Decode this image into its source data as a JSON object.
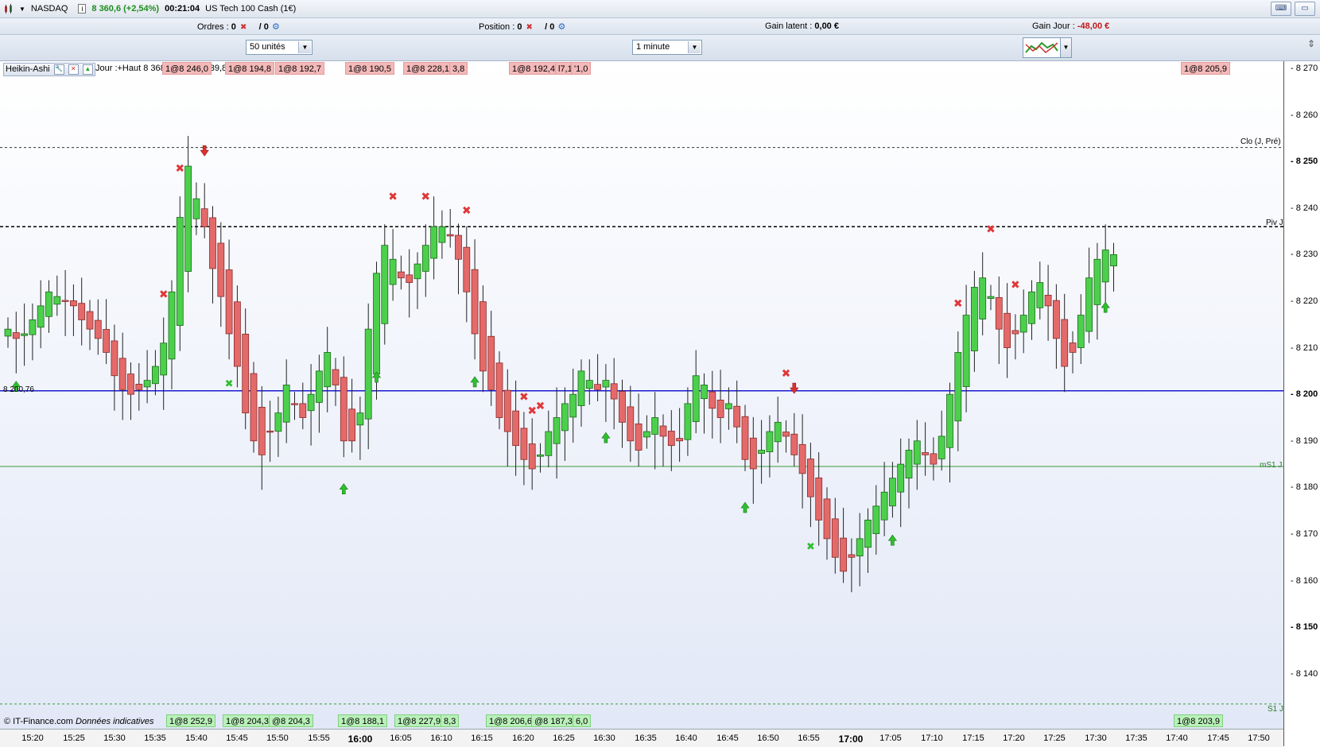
{
  "titlebar": {
    "symbol": "NASDAQ",
    "last": "8 360,6 (+2,54%)",
    "time": "00:21:04",
    "instrument": "US Tech 100 Cash (1€)"
  },
  "infobar": {
    "ordres_label": "Ordres :",
    "ordres_value": "0",
    "ordres_slash": "/ 0",
    "position_label": "Position :",
    "position_value": "0",
    "position_slash": "/ 0",
    "gain_latent_label": "Gain latent :",
    "gain_latent_value": "0,00 €",
    "gain_jour_label": "Gain Jour :",
    "gain_jour_value": "-48,00 €"
  },
  "controls": {
    "quantity": "50 unités",
    "timeframe": "1 minute"
  },
  "chart_header": {
    "style": "Heikin-Ashi",
    "ohlc": "Jour :+Haut 8 368,7 +Bas 8 039,8"
  },
  "top_tags": [
    "1@8 246,0",
    "1@8 194,8",
    "1@8 192,7",
    "1@8 190,5",
    "1@8 228,1",
    "3,8",
    "1@8 192,4",
    "l7,1",
    "'1,0",
    "1@8 205,9"
  ],
  "bottom_tags": [
    "1@8 252,9",
    "1@8 204,3",
    "@8 204,3",
    "1@8 188,1",
    "1@8 227,9",
    "8,3",
    "1@8 206,6",
    "@8 187,3",
    "6,0",
    "1@8 203,9"
  ],
  "footer": {
    "credit": "© IT-Finance.com",
    "note": "Données indicatives"
  },
  "line_labels": {
    "clo": "Clo (J, Pré)",
    "piv": "Piv J",
    "price_line": "8 200,76",
    "ms1": "mS1 J",
    "s1": "S1 J"
  },
  "chart_data": {
    "type": "candlestick",
    "style": "Heikin-Ashi",
    "ylim": [
      8132,
      8272
    ],
    "y_ticks": [
      8140,
      8150,
      8160,
      8170,
      8180,
      8190,
      8200,
      8210,
      8220,
      8230,
      8240,
      8250,
      8260,
      8270
    ],
    "y_ticks_bold": [
      8150,
      8200,
      8250
    ],
    "x_ticks": [
      "15:20",
      "15:25",
      "15:30",
      "15:35",
      "15:40",
      "15:45",
      "15:50",
      "15:55",
      "16:00",
      "16:05",
      "16:10",
      "16:15",
      "16:20",
      "16:25",
      "16:30",
      "16:35",
      "16:40",
      "16:45",
      "16:50",
      "16:55",
      "17:00",
      "17:05",
      "17:10",
      "17:15",
      "17:20",
      "17:25",
      "17:30",
      "17:35",
      "17:40",
      "17:45",
      "17:50"
    ],
    "x_ticks_bold": [
      "16:00",
      "17:00"
    ],
    "lines": {
      "clo": 8253,
      "piv": 8236,
      "price": 8200.76,
      "ms1": 8184.5,
      "s1": 8133.5
    },
    "closes": [
      8214,
      8212,
      8213,
      8216,
      8219,
      8222,
      8221,
      8220,
      8219,
      8216,
      8214,
      8212,
      8209,
      8204,
      8201,
      8200,
      8201,
      8203,
      8206,
      8211,
      8222,
      8238,
      8249,
      8242,
      8236,
      8227,
      8221,
      8213,
      8206,
      8196,
      8190,
      8187,
      8192,
      8196,
      8202,
      8198,
      8195,
      8200,
      8205,
      8209,
      8202,
      8190,
      8190,
      8196,
      8214,
      8226,
      8232,
      8229,
      8225,
      8224,
      8228,
      8232,
      8236,
      8236,
      8234,
      8229,
      8222,
      8213,
      8205,
      8201,
      8195,
      8192,
      8189,
      8186,
      8184,
      8187,
      8192,
      8195,
      8198,
      8200,
      8205,
      8203,
      8201,
      8203,
      8199,
      8194,
      8190,
      8188,
      8192,
      8195,
      8191,
      8189,
      8190,
      8198,
      8204,
      8202,
      8197,
      8195,
      8198,
      8193,
      8186,
      8184,
      8188,
      8192,
      8194,
      8191,
      8187,
      8183,
      8178,
      8173,
      8169,
      8165,
      8162,
      8165,
      8169,
      8173,
      8176,
      8179,
      8182,
      8185,
      8188,
      8190,
      8187,
      8185,
      8191,
      8200,
      8209,
      8217,
      8223,
      8225,
      8221,
      8214,
      8210,
      8213,
      8217,
      8222,
      8224,
      8219,
      8212,
      8206,
      8209,
      8217,
      8225,
      8229,
      8231,
      8230
    ],
    "up_markers": [
      1,
      41,
      45,
      57,
      73,
      90,
      108,
      134
    ],
    "down_markers": [],
    "cross_markers": [
      19,
      21,
      47,
      51,
      56,
      63,
      64,
      65,
      95,
      116,
      120,
      123
    ],
    "down_arrows": [
      24,
      96
    ],
    "crosses_green": [
      27,
      98
    ]
  }
}
